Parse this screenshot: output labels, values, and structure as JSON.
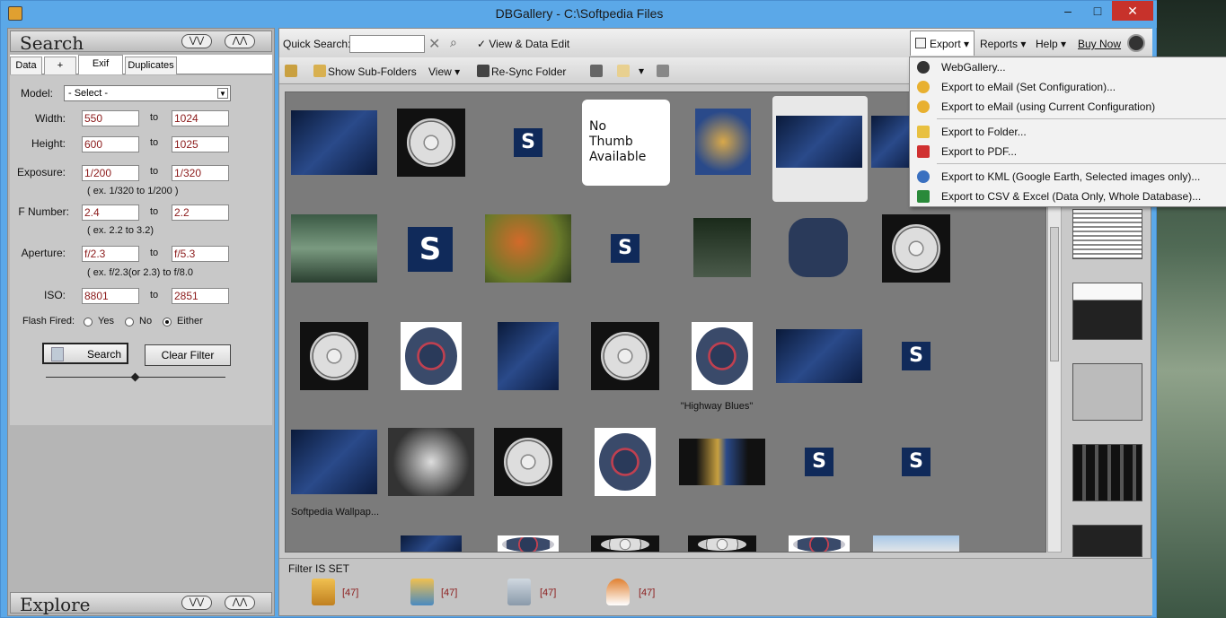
{
  "window": {
    "title": "DBGallery - C:\\Softpedia Files"
  },
  "search_panel": {
    "title": "Search",
    "tabs": [
      "Data",
      "+",
      "Exif",
      "Duplicates"
    ],
    "model_label": "Model:",
    "model_value": "- Select -",
    "to": "to",
    "fields": [
      {
        "label": "Width:",
        "from": "550",
        "to": "1024"
      },
      {
        "label": "Height:",
        "from": "600",
        "to": "1025"
      },
      {
        "label": "Exposure:",
        "from": "1/200",
        "to": "1/320",
        "hint": "( ex. 1/320  to   1/200 )"
      },
      {
        "label": "F Number:",
        "from": "2.4",
        "to": "2.2",
        "hint": "( ex. 2.2  to  3.2)"
      },
      {
        "label": "Aperture:",
        "from": "f/2.3",
        "to": "f/5.3",
        "hint": "( ex. f/2.3(or 2.3)  to  f/8.0"
      },
      {
        "label": "ISO:",
        "from": "8801",
        "to": "2851"
      }
    ],
    "flash_label": "Flash Fired:",
    "flash_options": [
      "Yes",
      "No",
      "Either"
    ],
    "search_button": "Search",
    "clear_button": "Clear Filter"
  },
  "explore_panel": {
    "title": "Explore"
  },
  "toolbar": {
    "quick_search_label": "Quick Search:",
    "quick_search_value": "",
    "view_data_edit": "View & Data Edit",
    "show_subfolders": "Show Sub-Folders",
    "view": "View",
    "resync": "Re-Sync Folder",
    "export": "Export",
    "reports": "Reports",
    "help": "Help",
    "buy_now": "Buy Now"
  },
  "export_menu": [
    "WebGallery...",
    "Export to eMail (Set Configuration)...",
    "Export to eMail (using Current Configuration)",
    "Export to Folder...",
    "Export to PDF...",
    "Export to KML (Google Earth, Selected images only)...",
    "Export to CSV & Excel (Data Only, Whole Database)..."
  ],
  "thumbnail_captions": {
    "no_thumb": "No\nThumb\nAvailable",
    "highway": "\"Highway Blues\"",
    "wallpaper": "Softpedia Wallpap..."
  },
  "status": {
    "filter": "Filter IS SET",
    "counts": [
      "[47]",
      "[47]",
      "[47]",
      "[47]"
    ]
  }
}
